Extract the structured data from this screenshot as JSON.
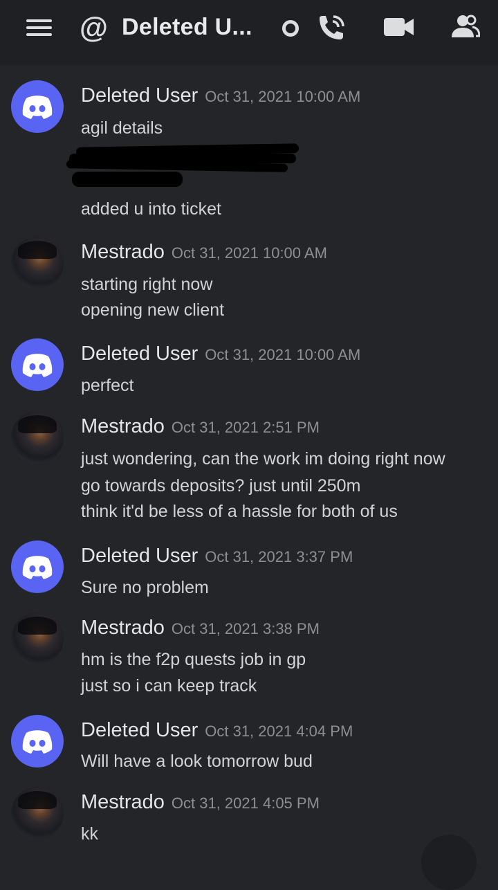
{
  "header": {
    "title": "Deleted U...",
    "at_symbol": "@"
  },
  "colors": {
    "discord_blurple": "#5965f2",
    "background": "#242528",
    "topbar": "#1f2023"
  },
  "messages": [
    {
      "author": "Deleted User",
      "time": "Oct 31, 2021 10:00 AM",
      "avatar": "discord-logo",
      "lines": [
        "agil details",
        "added u into ticket"
      ]
    },
    {
      "author": "Mestrado",
      "time": "Oct 31, 2021 10:00 AM",
      "avatar": "photo",
      "lines": [
        "starting right now",
        "opening new client"
      ]
    },
    {
      "author": "Deleted User",
      "time": "Oct 31, 2021 10:00 AM",
      "avatar": "discord-logo",
      "lines": [
        "perfect"
      ]
    },
    {
      "author": "Mestrado",
      "time": "Oct 31, 2021 2:51 PM",
      "avatar": "photo",
      "lines": [
        "just wondering, can the work im doing right now",
        "go towards deposits? just until 250m",
        "think it'd be less of a hassle for both of us"
      ]
    },
    {
      "author": "Deleted User",
      "time": "Oct 31, 2021 3:37 PM",
      "avatar": "discord-logo",
      "lines": [
        "Sure no problem"
      ]
    },
    {
      "author": "Mestrado",
      "time": "Oct 31, 2021 3:38 PM",
      "avatar": "photo",
      "lines": [
        "hm is the f2p quests job in gp",
        "just so i can keep track"
      ]
    },
    {
      "author": "Deleted User",
      "time": "Oct 31, 2021 4:04 PM",
      "avatar": "discord-logo",
      "lines": [
        "Will have a look tomorrow bud"
      ]
    },
    {
      "author": "Mestrado",
      "time": "Oct 31, 2021 4:05 PM",
      "avatar": "photo",
      "lines": [
        "kk"
      ]
    }
  ]
}
